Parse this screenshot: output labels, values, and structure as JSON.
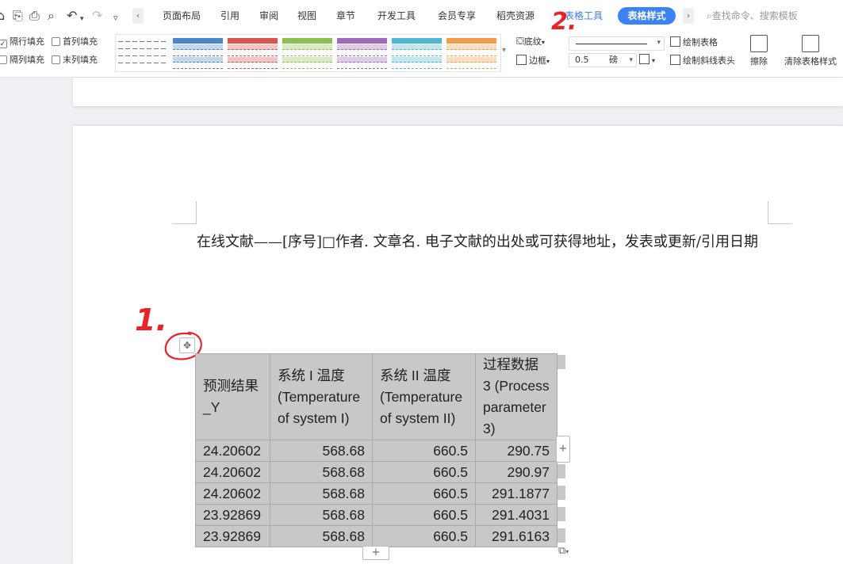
{
  "menu": {
    "tabs": [
      "页面布局",
      "引用",
      "审阅",
      "视图",
      "章节",
      "开发工具",
      "会员专享",
      "稻壳资源"
    ],
    "table_tools": "表格工具",
    "table_style_tab": "表格样式",
    "search_placeholder": "查找命令、搜索模板"
  },
  "ribbon": {
    "checkboxes": {
      "banded_rows": "隔行填充",
      "first_column": "首列填充",
      "banded_columns": "隔列填充",
      "last_column": "末列填充"
    },
    "shading": "底纹",
    "border": "边框",
    "line_width": "0.5",
    "line_width_unit": "磅",
    "draw_table": "绘制表格",
    "draw_diagonal_header": "绘制斜线表头",
    "erase": "擦除",
    "clear_table_style": "清除表格样式",
    "swatch_colors": [
      "#4a86c8",
      "#d9534f",
      "#8cc152",
      "#9b6ab8",
      "#4db6d0",
      "#f39c4a"
    ]
  },
  "document": {
    "reference_text": "在线文献——[序号]□作者. 文章名. 电子文献的出处或可获得地址，发表或更新/引用日期"
  },
  "annotations": {
    "step1": "1.",
    "step2": "2."
  },
  "table": {
    "headers": [
      "预测结果_Y",
      "系统 I 温度 (Temperature of system I)",
      "系统 II 温度 (Temperature of system II)",
      "过程数据 3 (Process parameter 3)"
    ],
    "rows": [
      [
        "24.20602",
        "568.68",
        "660.5",
        "290.75"
      ],
      [
        "24.20602",
        "568.68",
        "660.5",
        "290.97"
      ],
      [
        "24.20602",
        "568.68",
        "660.5",
        "291.1877"
      ],
      [
        "23.92869",
        "568.68",
        "660.5",
        "291.4031"
      ],
      [
        "23.92869",
        "568.68",
        "660.5",
        "291.6163"
      ]
    ]
  }
}
